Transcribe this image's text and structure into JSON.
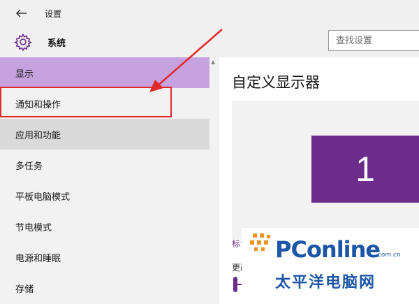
{
  "window": {
    "title": "设置"
  },
  "header": {
    "section_title": "系统",
    "search_placeholder": "查找设置"
  },
  "sidebar": {
    "items": [
      {
        "label": "显示",
        "state": "selected"
      },
      {
        "label": "通知和操作",
        "state": "annotated"
      },
      {
        "label": "应用和功能",
        "state": "hover"
      },
      {
        "label": "多任务",
        "state": "normal"
      },
      {
        "label": "平板电脑模式",
        "state": "normal"
      },
      {
        "label": "节电模式",
        "state": "normal"
      },
      {
        "label": "电源和睡眠",
        "state": "normal"
      },
      {
        "label": "存储",
        "state": "normal"
      }
    ]
  },
  "content": {
    "title": "自定义显示器",
    "monitor_number": "1",
    "identify_link": "标识",
    "change_label": "更改"
  },
  "watermark": {
    "brand": "PConline",
    "domain": ".com.cn",
    "cn_name": "太平洋电脑网"
  },
  "colors": {
    "accent": "#6b2c8c",
    "selected_bg": "#c6a2de",
    "annotation_red": "#e02a2a",
    "watermark_blue": "#1d56a6"
  },
  "icons": {
    "back": "back-arrow-icon",
    "settings": "gear-icon"
  }
}
